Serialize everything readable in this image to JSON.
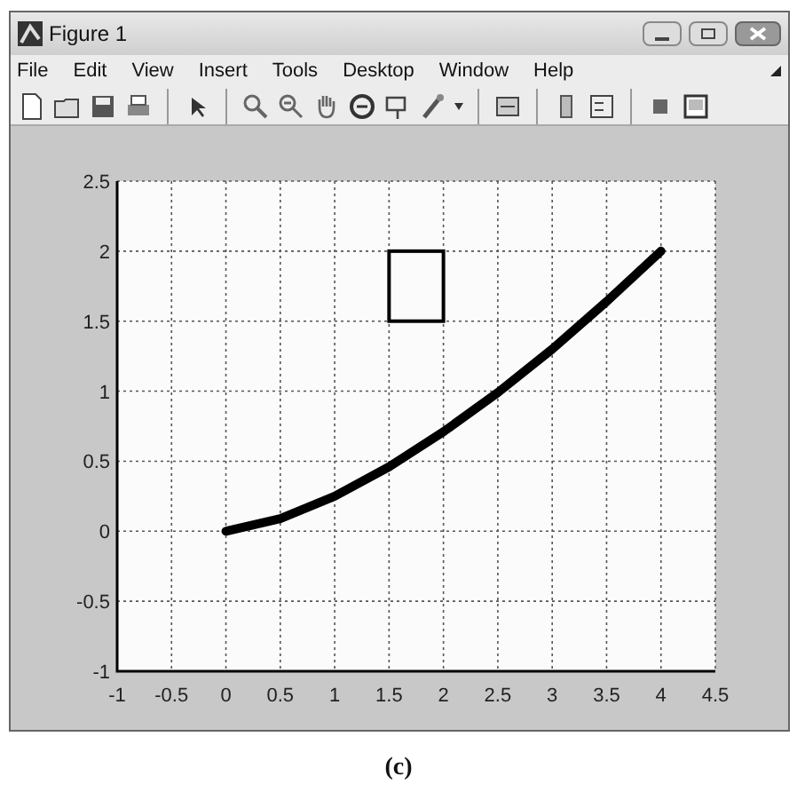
{
  "window": {
    "title": "Figure 1"
  },
  "menu": [
    "File",
    "Edit",
    "View",
    "Insert",
    "Tools",
    "Desktop",
    "Window",
    "Help"
  ],
  "plot": {
    "chart_data": {
      "type": "line",
      "x": [
        0,
        0.5,
        1,
        1.5,
        2,
        2.5,
        3,
        3.5,
        4
      ],
      "series": [
        {
          "color": "#000000",
          "values": [
            0,
            0.09,
            0.25,
            0.46,
            0.71,
            0.99,
            1.3,
            1.64,
            2
          ]
        }
      ],
      "xlim": [
        -1,
        4.5
      ],
      "ylim": [
        -1,
        2.5
      ],
      "xticks": [
        -1,
        -0.5,
        0,
        0.5,
        1,
        1.5,
        2,
        2.5,
        3,
        3.5,
        4,
        4.5
      ],
      "yticks": [
        -1,
        -0.5,
        0,
        0.5,
        1,
        1.5,
        2,
        2.5
      ],
      "grid": true
    },
    "overlay": {
      "kind": "rectangle"
    }
  },
  "caption": "(c)"
}
